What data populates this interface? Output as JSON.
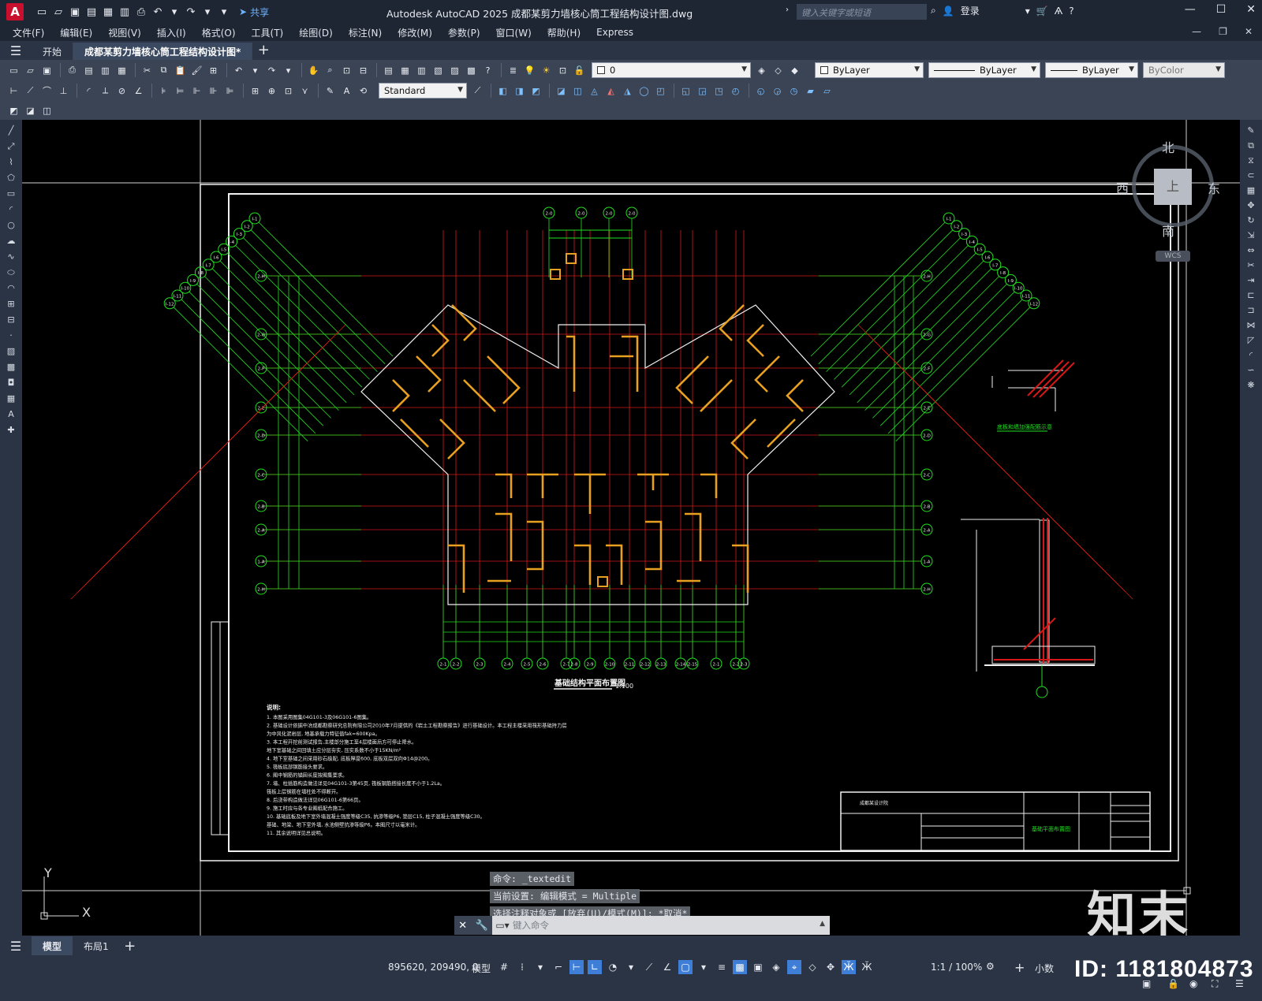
{
  "titlebar": {
    "app_logo": "A",
    "share_label": "共享",
    "title": "Autodesk AutoCAD 2025    成都某剪力墙核心筒工程结构设计图.dwg",
    "search_placeholder": "键入关键字或短语",
    "login_label": "登录"
  },
  "menu": {
    "items": [
      "文件(F)",
      "编辑(E)",
      "视图(V)",
      "插入(I)",
      "格式(O)",
      "工具(T)",
      "绘图(D)",
      "标注(N)",
      "修改(M)",
      "参数(P)",
      "窗口(W)",
      "帮助(H)",
      "Express"
    ]
  },
  "tabs": {
    "start_label": "开始",
    "doc_label": "成都某剪力墙核心筒工程结构设计图*",
    "add_label": "+"
  },
  "toolbar": {
    "layer_value": "0",
    "color_value": "ByLayer",
    "linetype_value": "ByLayer",
    "lineweight_value": "ByLayer",
    "plotstyle_value": "ByColor",
    "dimstyle_value": "Standard"
  },
  "viewcube": {
    "north": "北",
    "south": "南",
    "west": "西",
    "east": "东",
    "top": "上",
    "wcs": "WCS"
  },
  "drawing": {
    "plan_title": "基础结构平面布置图",
    "plan_scale": "1:100",
    "detail_title": "底板和墙加强配筋示意",
    "notes_heading": "说明:",
    "notes": [
      "1. 本图采用图集04G101-3及06G101-6图集。",
      "2. 基础设计依据中冶成都勘察研究总院有限公司2010年7月提供的《岩土工程勘察报告》进行基础设计。本工程主楼采用筏形基础持力层",
      "   为中风化泥岩层, 地基承载力特征值fak=600Kpa。",
      "3. 本工程开挖前测试报告,主楼部分施工至4层楼面后方可停止降水。",
      "   地下室基础之间回填土应分层夯实, 压实系数不小于15KN/m²",
      "4. 地下室基础之间采用砂石级配, 底板厚度600, 底板双层双向Φ14@200。",
      "5. 筏板底部钢筋接头要求。",
      "6. 图中钢筋的锚固长度按图集要求。",
      "7. 墙、柱插筋构造做法详见04G101-3第45页, 筏板钢筋搭接长度不小于1.2La。",
      "   筏板上层钢筋在墙柱处不得断开。",
      "8. 后浇带构造做法详见06G101-6第66页。",
      "9. 施工时应与各专业图纸配合施工。",
      "10. 基础底板及地下室外墙混凝土强度等级C35, 抗渗等级P6, 垫层C15, 柱子混凝土强度等级C30。",
      "    基础、地梁、地下室外墙, 水池侧壁抗渗等级P6。本图尺寸以毫米计。",
      "11. 其余说明详见总说明。"
    ],
    "titleblock_rows": [
      "成都某设计院",
      "基础平面布置图"
    ],
    "grid_labels_top": [
      "2-0",
      "2-0",
      "2-0",
      "2-0"
    ],
    "grid_labels_left": [
      "2-H",
      "2-G",
      "2-F",
      "2-E",
      "2-D",
      "2-C",
      "2-B",
      "2-A",
      "1-A"
    ],
    "grid_labels_bottom": [
      "2-1",
      "2-2",
      "2-3",
      "2-4",
      "2-5",
      "2-6",
      "2-7",
      "2-8",
      "2-9",
      "2-10",
      "2-11",
      "2-12",
      "2-13",
      "2-14",
      "2-15"
    ]
  },
  "command": {
    "history": [
      "命令: _textedit",
      "当前设置: 编辑模式 = Multiple",
      "选择注释对象或 [放弃(U)/模式(M)]: *取消*"
    ],
    "input_placeholder": "键入命令"
  },
  "ucs": {
    "x": "X",
    "y": "Y"
  },
  "watermark": {
    "brand": "知末",
    "id": "ID: 1181804873"
  },
  "layouts": {
    "items": [
      "模型",
      "布局1"
    ],
    "add_label": "+"
  },
  "status": {
    "coords": "895620, 209490, 0",
    "space": "模型",
    "annotation_scale": "1:1 / 100%",
    "units": "小数"
  },
  "colors": {
    "chrome_dark": "#1f2633",
    "chrome_mid": "#2b3444",
    "toolbar": "#3b4455",
    "grid_green": "#22e022",
    "wall_yellow": "#e8a020",
    "rebar_red": "#d41818",
    "frame_white": "#f0f0f0",
    "accent_blue": "#3f7ed6"
  }
}
